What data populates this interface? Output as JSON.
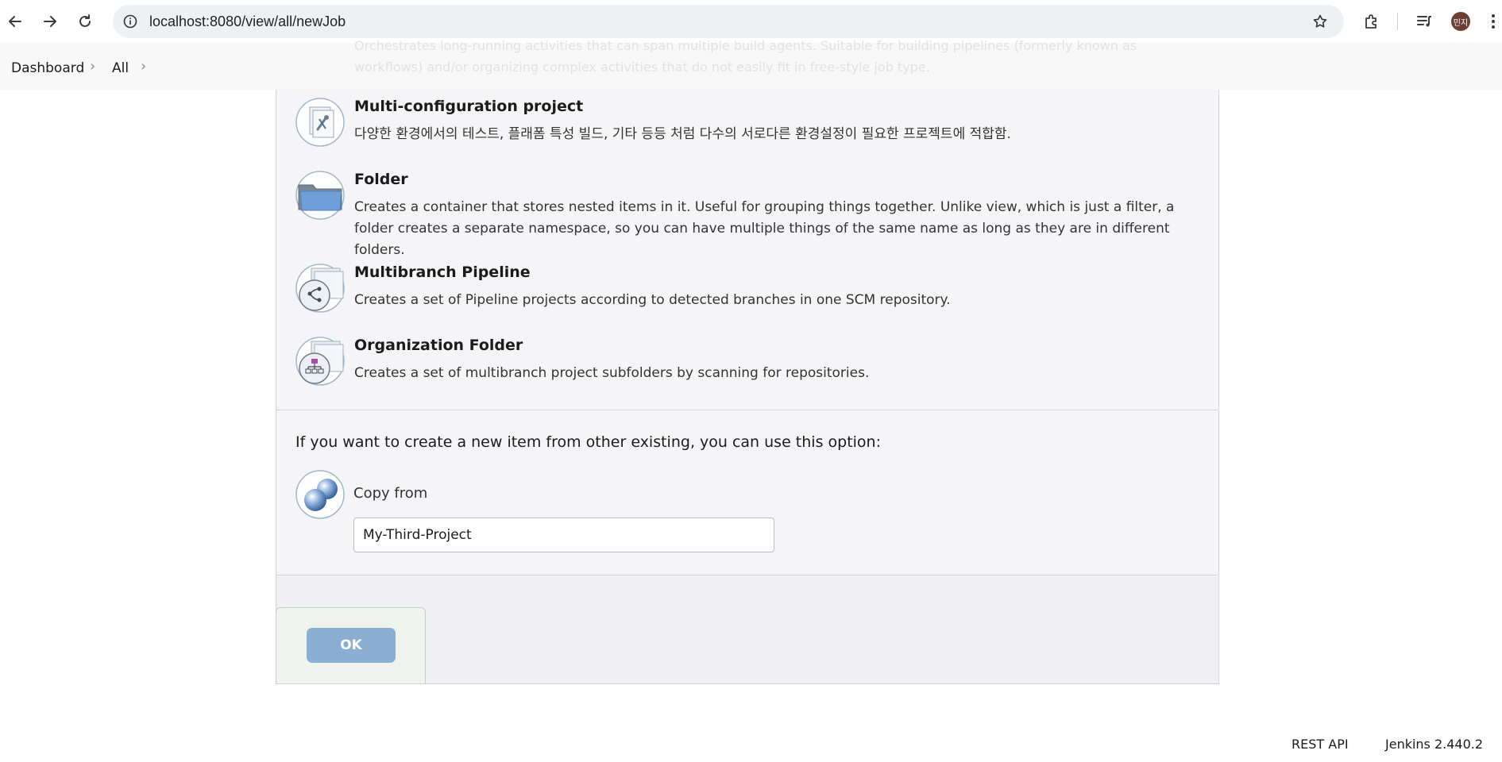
{
  "browser": {
    "url": "localhost:8080/view/all/newJob",
    "avatar_text": "민지"
  },
  "breadcrumb": {
    "items": [
      "Dashboard",
      "All"
    ]
  },
  "ghost_text": {
    "line1": "Orchestrates long-running activities that can span multiple build agents. Suitable for building pipelines (formerly known as",
    "line2": "workflows) and/or organizing complex activities that do not easily fit in free-style job type."
  },
  "items": [
    {
      "title": "Multi-configuration project",
      "description": "다양한 환경에서의 테스트, 플래폼 특성 빌드, 기타 등등 처럼 다수의 서로다른 환경설정이 필요한 프로젝트에 적합함.",
      "icon": "multi-config-icon"
    },
    {
      "title": "Folder",
      "description": "Creates a container that stores nested items in it. Useful for grouping things together. Unlike view, which is just a filter, a folder creates a separate namespace, so you can have multiple things of the same name as long as they are in different folders.",
      "icon": "folder-icon"
    },
    {
      "title": "Multibranch Pipeline",
      "description": "Creates a set of Pipeline projects according to detected branches in one SCM repository.",
      "icon": "multibranch-pipeline-icon"
    },
    {
      "title": "Organization Folder",
      "description": "Creates a set of multibranch project subfolders by scanning for repositories.",
      "icon": "organization-folder-icon"
    }
  ],
  "copy": {
    "lead": "If you want to create a new item from other existing, you can use this option:",
    "label": "Copy from",
    "value": "My-Third-Project"
  },
  "actions": {
    "ok_label": "OK"
  },
  "footer": {
    "rest_api": "REST API",
    "version": "Jenkins 2.440.2"
  },
  "colors": {
    "ok_button": "#8aaed2",
    "panel_bg": "#f5f5f7",
    "avatar_bg": "#6b3f33"
  }
}
